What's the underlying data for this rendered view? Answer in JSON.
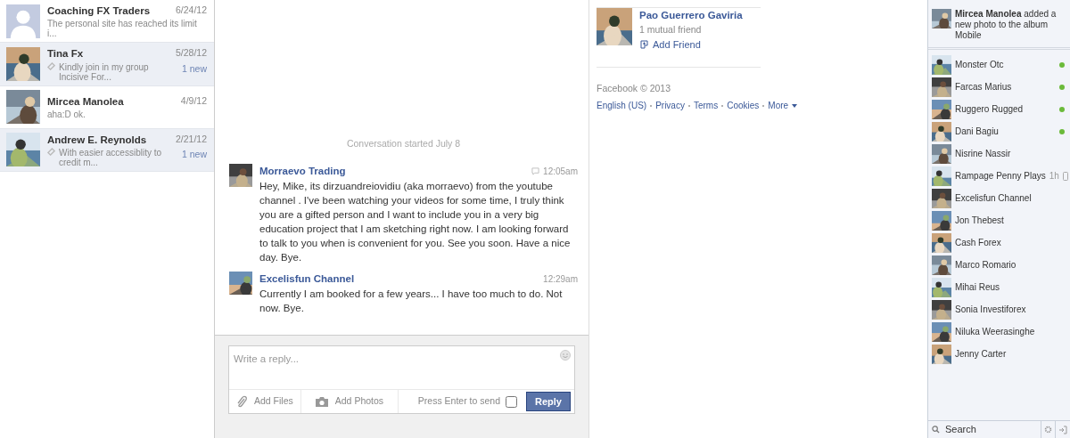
{
  "threads": [
    {
      "name": "Coaching FX Traders",
      "date": "6/24/12",
      "snippet": "The personal site has reached its limit i...",
      "unread": false,
      "default_avatar": true
    },
    {
      "name": "Tina Fx",
      "date": "5/28/12",
      "snippet": "Kindly join in my group Incisive For...",
      "unread": true,
      "replied": true,
      "new_count": "1 new",
      "default_avatar": false
    },
    {
      "name": "Mircea Manolea",
      "date": "4/9/12",
      "snippet": "aha:D ok.",
      "unread": false,
      "default_avatar": false
    },
    {
      "name": "Andrew E. Reynolds",
      "date": "2/21/12",
      "snippet": "With easier accessiblity to credit m...",
      "unread": true,
      "replied": true,
      "new_count": "1 new",
      "default_avatar": false
    }
  ],
  "conversation": {
    "started": "Conversation started July 8",
    "messages": [
      {
        "sender": "Morraevo Trading",
        "time": "12:05am",
        "via_chat": true,
        "text": "Hey, Mike, its dirzuandreiovidiu (aka morraevo) from the youtube channel . I've been watching your videos for some time, I truly think you are a gifted person and I want to include you in a very big education project that I am sketching right now. I am looking forward to talk to you when is convenient for you. See you soon. Have a nice day. Bye."
      },
      {
        "sender": "Excelisfun Channel",
        "time": "12:29am",
        "text": "Currently I am booked for a few years... I have too much to do. Not now. Bye."
      }
    ]
  },
  "composer": {
    "placeholder": "Write a reply...",
    "add_files": "Add Files",
    "add_photos": "Add Photos",
    "enter_label": "Press Enter to send",
    "enter_to_send": false,
    "reply_button": "Reply"
  },
  "suggestion": {
    "name": "Pao Guerrero Gaviria",
    "mutual": "1 mutual friend",
    "action": "Add Friend"
  },
  "footer": {
    "copyright": "Facebook © 2013",
    "links": [
      "English (US)",
      "Privacy",
      "Terms",
      "Cookies",
      "More"
    ]
  },
  "ticker": [
    {
      "actor": "Mircea Manolea",
      "text": "added a new photo to the album Mobile"
    }
  ],
  "chat": [
    {
      "name": "Monster Otc",
      "online": true
    },
    {
      "name": "Farcas Marius",
      "online": true
    },
    {
      "name": "Ruggero Rugged",
      "online": true
    },
    {
      "name": "Dani Bagiu",
      "online": true
    },
    {
      "name": "Nisrine Nassir",
      "online": false
    },
    {
      "name": "Rampage Penny Plays",
      "online": false,
      "mobile": true,
      "idle": "1h"
    },
    {
      "name": "Excelisfun Channel",
      "online": false
    },
    {
      "name": "Jon Thebest",
      "online": false
    },
    {
      "name": "Cash Forex",
      "online": false
    },
    {
      "name": "Marco Romario",
      "online": false
    },
    {
      "name": "Mihai Reus",
      "online": false
    },
    {
      "name": "Sonia Investiforex",
      "online": false
    },
    {
      "name": "Niluka Weerasinghe",
      "online": false
    },
    {
      "name": "Jenny Carter",
      "online": false
    }
  ],
  "chat_search": {
    "placeholder": "Search"
  }
}
